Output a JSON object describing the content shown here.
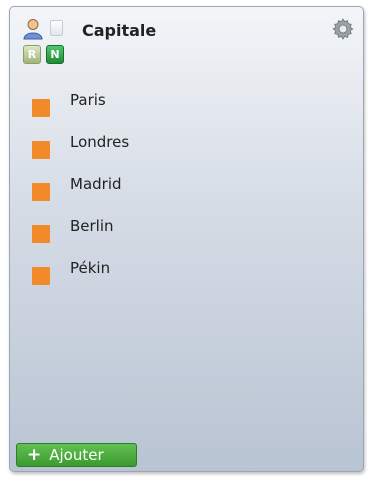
{
  "header": {
    "title": "Capitale",
    "badges": [
      "R",
      "N"
    ],
    "icons": [
      "user-icon",
      "document-icon",
      "gear-icon"
    ]
  },
  "list": {
    "items": [
      {
        "label": "Paris"
      },
      {
        "label": "Londres"
      },
      {
        "label": "Madrid"
      },
      {
        "label": "Berlin"
      },
      {
        "label": "Pékin"
      }
    ],
    "bullet_color": "#f28a2a"
  },
  "footer": {
    "add_label": "Ajouter",
    "add_color": "#4aa83b"
  }
}
